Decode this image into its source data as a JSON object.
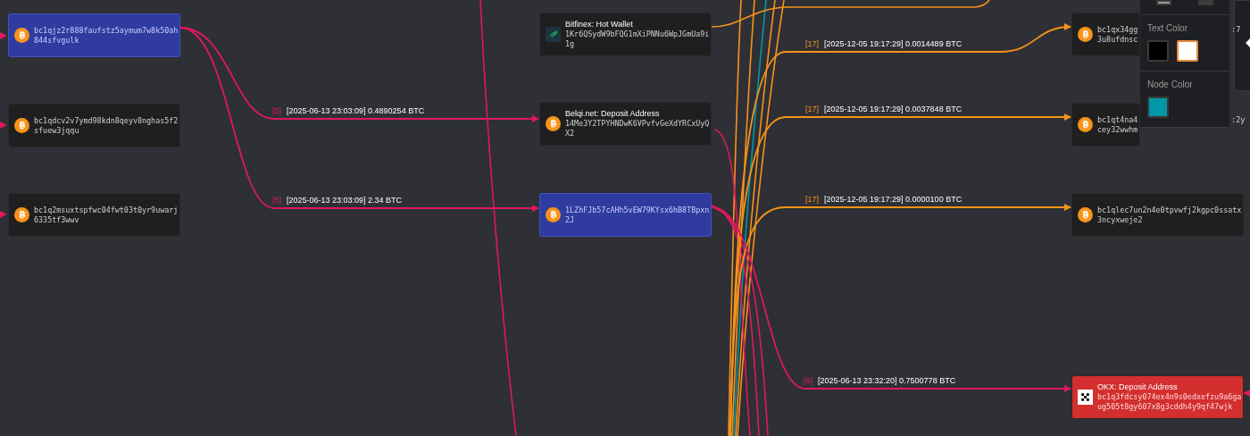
{
  "nodes": [
    {
      "kind": "btc",
      "selected": true,
      "address": [
        "bc1qjz2r888faufstz5aymum7w8k50ah",
        "844sfvgulk"
      ]
    },
    {
      "kind": "btc",
      "selected": false,
      "address": [
        "bc1qdcv2v7ymd98kdn8qeyv8nghas5f2",
        "sfuew3jqqu"
      ]
    },
    {
      "kind": "btc",
      "selected": false,
      "address": [
        "bc1q2msuxtspfwc04fwt03t0yr9uwarj",
        "6335tf3wwv"
      ]
    },
    {
      "kind": "bitfinex",
      "selected": false,
      "title": "Bitfinex: Hot Wallet",
      "address": [
        "1Kr6QSydW9bFQG1mXiPNNu6WpJGmUa9i",
        "1g"
      ]
    },
    {
      "kind": "btc",
      "selected": false,
      "title": "Belqi.net: Deposit Address",
      "address": [
        "14Me3Y2TPYHNDwK6VPvfvGeXdYRCxUyQ",
        "X2"
      ]
    },
    {
      "kind": "btc",
      "selected": true,
      "address": [
        "1LZhFJb57cAHh5vEW79KYsx6hB8TBpxn",
        "2J"
      ]
    },
    {
      "kind": "btc",
      "selected": false,
      "address": [
        "bc1qx34gg",
        "3u8ufdnsc"
      ],
      "address_tail": ":7"
    },
    {
      "kind": "btc",
      "selected": false,
      "address": [
        "bc1qt4na4",
        "cey32wwhm"
      ],
      "address_tail": ":2y"
    },
    {
      "kind": "btc",
      "selected": false,
      "address": [
        "bc1qlec7un2n4e0tpvwfj2kgpc0ssatx",
        "3ncyxweje2"
      ]
    },
    {
      "kind": "okx",
      "selected": false,
      "color": "#d32f2f",
      "title": "OKX: Deposit Address",
      "address": [
        "bc1q3fdcsy074ex4n9s0edxefzu9a6ga",
        "ug505t8gy607x8g3cddh4y9qf47wjk"
      ]
    }
  ],
  "edges": [
    {
      "color": "#e0185c",
      "index": "[5]",
      "text": "[2025-06-13 23:03:09] 0.4890254 BTC"
    },
    {
      "color": "#e0185c",
      "index": "[5]",
      "text": "[2025-06-13 23:03:09] 2.34 BTC"
    },
    {
      "color": "#f7931a",
      "index": "[17]",
      "text": "[2025-12-05 19:17:29] 0.0014489 BTC"
    },
    {
      "color": "#f7931a",
      "index": "[17]",
      "text": "[2025-12-05 19:17:29] 0.0037848 BTC"
    },
    {
      "color": "#f7931a",
      "index": "[17]",
      "text": "[2025-12-05 19:17:29] 0.0000100 BTC"
    },
    {
      "color": "#e0185c",
      "index": "[6]",
      "text": "[2025-06-13 23:32:20] 0.7500778 BTC"
    }
  ],
  "style_panel": {
    "top_swatches": [
      {
        "color": "#9e9e9e",
        "selected": false
      },
      {
        "color": "#424242",
        "selected": false
      }
    ],
    "sections": [
      {
        "title": "Text Color",
        "swatches": [
          {
            "color": "#000000",
            "selected": false
          },
          {
            "color": "#ffffff",
            "selected": true
          }
        ]
      },
      {
        "title": "Node Color",
        "swatches": [
          {
            "color": "#0097a7",
            "selected": false
          }
        ]
      }
    ]
  }
}
